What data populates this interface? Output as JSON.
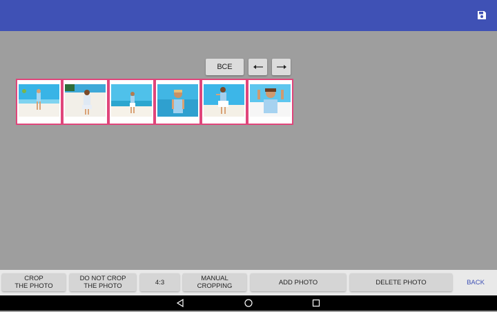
{
  "colors": {
    "appbar": "#3f51b5",
    "background": "#9e9e9e",
    "thumb_border": "#e0457b",
    "back_text": "#3f51b5"
  },
  "appbar": {
    "save_icon": "save-icon"
  },
  "controls": {
    "all_label": "ВСЕ",
    "prev_icon": "arrow-left-icon",
    "next_icon": "arrow-right-icon"
  },
  "thumbnails": [
    {
      "icon": "photo-thumbnail-1"
    },
    {
      "icon": "photo-thumbnail-2"
    },
    {
      "icon": "photo-thumbnail-3"
    },
    {
      "icon": "photo-thumbnail-4"
    },
    {
      "icon": "photo-thumbnail-5"
    },
    {
      "icon": "photo-thumbnail-6"
    }
  ],
  "actions": {
    "crop": "CROP\nTHE PHOTO",
    "no_crop": "DO NOT CROP\nTHE PHOTO",
    "ratio": "4:3",
    "manual": "MANUAL\nCROPPING",
    "add": "ADD PHOTO",
    "delete": "DELETE PHOTO",
    "back": "BACK"
  },
  "navbar": {
    "back_icon": "nav-back-icon",
    "home_icon": "nav-home-icon",
    "recent_icon": "nav-recent-icon"
  }
}
